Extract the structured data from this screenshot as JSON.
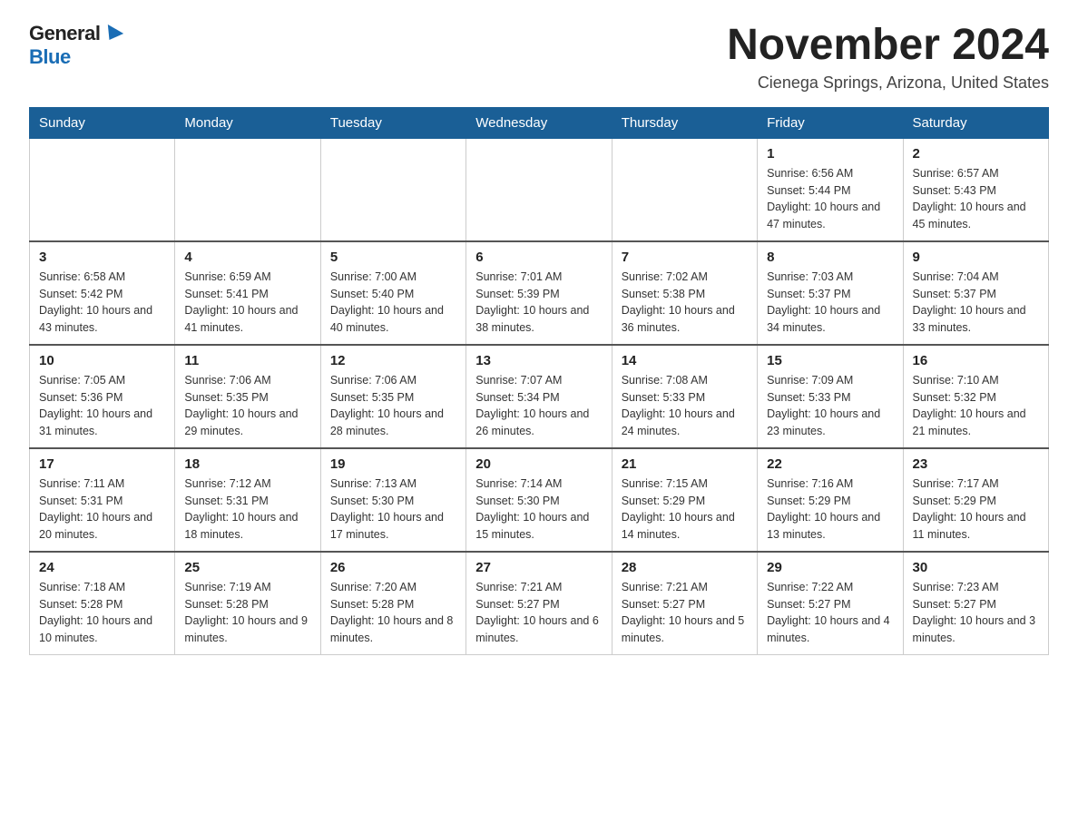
{
  "logo": {
    "general": "General",
    "blue": "Blue"
  },
  "header": {
    "month_title": "November 2024",
    "location": "Cienega Springs, Arizona, United States"
  },
  "weekdays": [
    "Sunday",
    "Monday",
    "Tuesday",
    "Wednesday",
    "Thursday",
    "Friday",
    "Saturday"
  ],
  "weeks": [
    [
      {
        "day": "",
        "info": ""
      },
      {
        "day": "",
        "info": ""
      },
      {
        "day": "",
        "info": ""
      },
      {
        "day": "",
        "info": ""
      },
      {
        "day": "",
        "info": ""
      },
      {
        "day": "1",
        "info": "Sunrise: 6:56 AM\nSunset: 5:44 PM\nDaylight: 10 hours and 47 minutes."
      },
      {
        "day": "2",
        "info": "Sunrise: 6:57 AM\nSunset: 5:43 PM\nDaylight: 10 hours and 45 minutes."
      }
    ],
    [
      {
        "day": "3",
        "info": "Sunrise: 6:58 AM\nSunset: 5:42 PM\nDaylight: 10 hours and 43 minutes."
      },
      {
        "day": "4",
        "info": "Sunrise: 6:59 AM\nSunset: 5:41 PM\nDaylight: 10 hours and 41 minutes."
      },
      {
        "day": "5",
        "info": "Sunrise: 7:00 AM\nSunset: 5:40 PM\nDaylight: 10 hours and 40 minutes."
      },
      {
        "day": "6",
        "info": "Sunrise: 7:01 AM\nSunset: 5:39 PM\nDaylight: 10 hours and 38 minutes."
      },
      {
        "day": "7",
        "info": "Sunrise: 7:02 AM\nSunset: 5:38 PM\nDaylight: 10 hours and 36 minutes."
      },
      {
        "day": "8",
        "info": "Sunrise: 7:03 AM\nSunset: 5:37 PM\nDaylight: 10 hours and 34 minutes."
      },
      {
        "day": "9",
        "info": "Sunrise: 7:04 AM\nSunset: 5:37 PM\nDaylight: 10 hours and 33 minutes."
      }
    ],
    [
      {
        "day": "10",
        "info": "Sunrise: 7:05 AM\nSunset: 5:36 PM\nDaylight: 10 hours and 31 minutes."
      },
      {
        "day": "11",
        "info": "Sunrise: 7:06 AM\nSunset: 5:35 PM\nDaylight: 10 hours and 29 minutes."
      },
      {
        "day": "12",
        "info": "Sunrise: 7:06 AM\nSunset: 5:35 PM\nDaylight: 10 hours and 28 minutes."
      },
      {
        "day": "13",
        "info": "Sunrise: 7:07 AM\nSunset: 5:34 PM\nDaylight: 10 hours and 26 minutes."
      },
      {
        "day": "14",
        "info": "Sunrise: 7:08 AM\nSunset: 5:33 PM\nDaylight: 10 hours and 24 minutes."
      },
      {
        "day": "15",
        "info": "Sunrise: 7:09 AM\nSunset: 5:33 PM\nDaylight: 10 hours and 23 minutes."
      },
      {
        "day": "16",
        "info": "Sunrise: 7:10 AM\nSunset: 5:32 PM\nDaylight: 10 hours and 21 minutes."
      }
    ],
    [
      {
        "day": "17",
        "info": "Sunrise: 7:11 AM\nSunset: 5:31 PM\nDaylight: 10 hours and 20 minutes."
      },
      {
        "day": "18",
        "info": "Sunrise: 7:12 AM\nSunset: 5:31 PM\nDaylight: 10 hours and 18 minutes."
      },
      {
        "day": "19",
        "info": "Sunrise: 7:13 AM\nSunset: 5:30 PM\nDaylight: 10 hours and 17 minutes."
      },
      {
        "day": "20",
        "info": "Sunrise: 7:14 AM\nSunset: 5:30 PM\nDaylight: 10 hours and 15 minutes."
      },
      {
        "day": "21",
        "info": "Sunrise: 7:15 AM\nSunset: 5:29 PM\nDaylight: 10 hours and 14 minutes."
      },
      {
        "day": "22",
        "info": "Sunrise: 7:16 AM\nSunset: 5:29 PM\nDaylight: 10 hours and 13 minutes."
      },
      {
        "day": "23",
        "info": "Sunrise: 7:17 AM\nSunset: 5:29 PM\nDaylight: 10 hours and 11 minutes."
      }
    ],
    [
      {
        "day": "24",
        "info": "Sunrise: 7:18 AM\nSunset: 5:28 PM\nDaylight: 10 hours and 10 minutes."
      },
      {
        "day": "25",
        "info": "Sunrise: 7:19 AM\nSunset: 5:28 PM\nDaylight: 10 hours and 9 minutes."
      },
      {
        "day": "26",
        "info": "Sunrise: 7:20 AM\nSunset: 5:28 PM\nDaylight: 10 hours and 8 minutes."
      },
      {
        "day": "27",
        "info": "Sunrise: 7:21 AM\nSunset: 5:27 PM\nDaylight: 10 hours and 6 minutes."
      },
      {
        "day": "28",
        "info": "Sunrise: 7:21 AM\nSunset: 5:27 PM\nDaylight: 10 hours and 5 minutes."
      },
      {
        "day": "29",
        "info": "Sunrise: 7:22 AM\nSunset: 5:27 PM\nDaylight: 10 hours and 4 minutes."
      },
      {
        "day": "30",
        "info": "Sunrise: 7:23 AM\nSunset: 5:27 PM\nDaylight: 10 hours and 3 minutes."
      }
    ]
  ]
}
